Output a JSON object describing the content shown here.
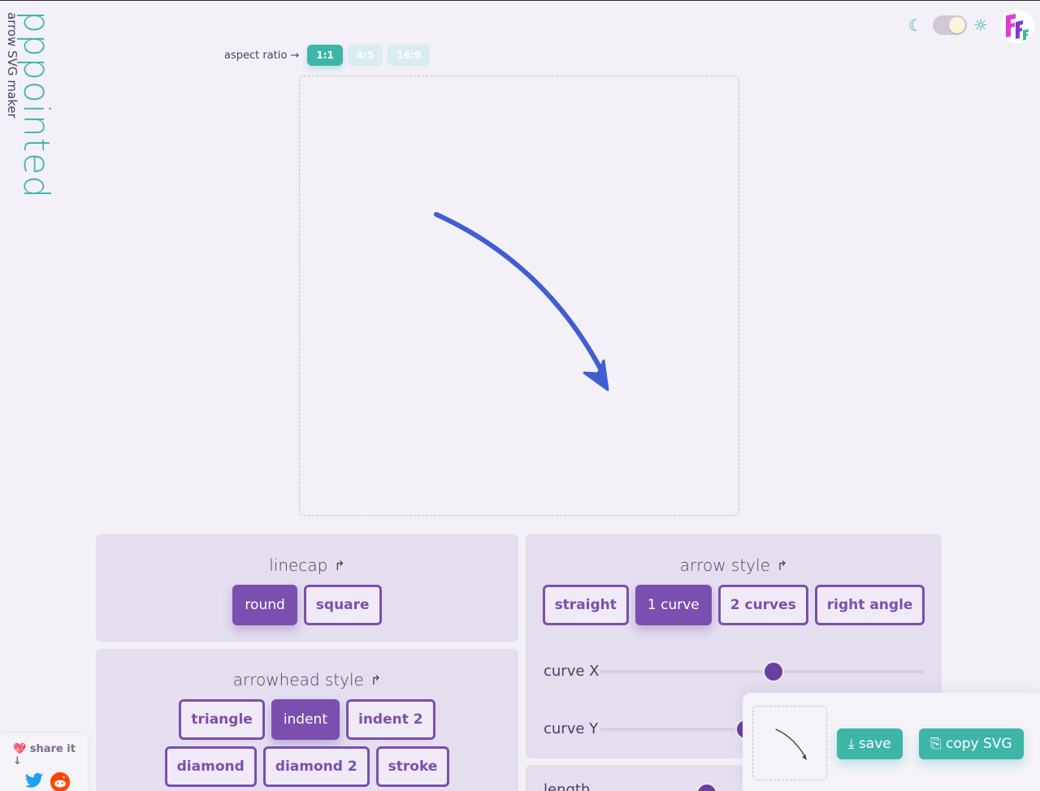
{
  "brand": {
    "name": "pppointed",
    "tagline": "arrow SVG maker"
  },
  "theme": {
    "moon_icon": "☾",
    "sun_icon": "☼",
    "mode": "light"
  },
  "aspect": {
    "label": "aspect ratio →",
    "options": [
      "1:1",
      "4:5",
      "16:9"
    ],
    "selected": "1:1"
  },
  "linecap": {
    "title": "linecap",
    "reset_icon": "↱",
    "options": [
      "round",
      "square"
    ],
    "selected": "round"
  },
  "arrowhead": {
    "title": "arrowhead style",
    "reset_icon": "↱",
    "options": [
      "triangle",
      "indent",
      "indent 2",
      "diamond",
      "diamond 2",
      "stroke"
    ],
    "selected": "indent"
  },
  "arrow_style": {
    "title": "arrow style",
    "reset_icon": "↱",
    "options": [
      "straight",
      "1 curve",
      "2 curves",
      "right angle"
    ],
    "selected": "1 curve"
  },
  "sliders": {
    "curve_x": {
      "label": "curve X",
      "value": 0.52
    },
    "curve_y": {
      "label": "curve Y"
    }
  },
  "length_label": "length",
  "share": {
    "label": "💖 share it ↓"
  },
  "export": {
    "save_label": "⤓ save",
    "copy_label": "⎘ copy SVG"
  },
  "colors": {
    "accent": "#3fb5a8",
    "purple": "#7a4fb0",
    "arrow": "#3f5fd1"
  }
}
